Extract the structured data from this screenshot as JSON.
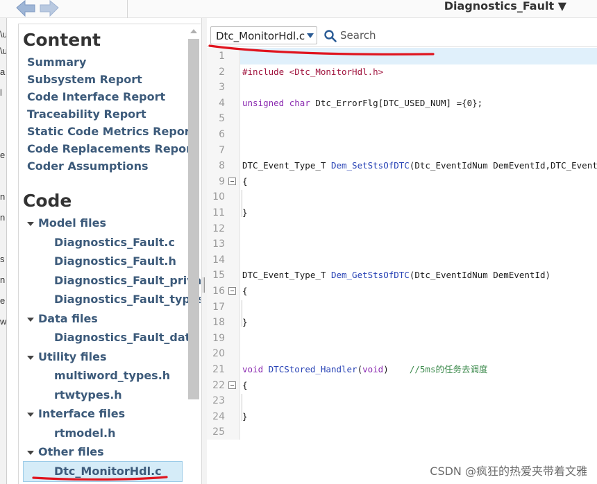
{
  "window": {
    "title": "Diagnostics_Fault ▼"
  },
  "content_panel": {
    "content_heading": "Content",
    "reports": [
      "Summary",
      "Subsystem Report",
      "Code Interface Report",
      "Traceability Report",
      "Static Code Metrics Report",
      "Code Replacements Report",
      "Coder Assumptions"
    ],
    "code_heading": "Code",
    "groups": [
      {
        "label": "Model files",
        "files": [
          "Diagnostics_Fault.c",
          "Diagnostics_Fault.h",
          "Diagnostics_Fault_priva",
          "Diagnostics_Fault_types"
        ]
      },
      {
        "label": "Data files",
        "files": [
          "Diagnostics_Fault_data"
        ]
      },
      {
        "label": "Utility files",
        "files": [
          "multiword_types.h",
          "rtwtypes.h"
        ]
      },
      {
        "label": "Interface files",
        "files": [
          "rtmodel.h"
        ]
      },
      {
        "label": "Other files",
        "files": [
          "Dtc_MonitorHdl.c"
        ]
      }
    ],
    "selected_file": "Dtc_MonitorHdl.c"
  },
  "code_view": {
    "file_selector_value": "Dtc_MonitorHdl.c",
    "search_placeholder": "Search",
    "lines": [
      {
        "num": "1",
        "text": ""
      },
      {
        "num": "2",
        "text": "#include <Dtc_MonitorHdl.h>"
      },
      {
        "num": "3",
        "text": ""
      },
      {
        "num": "4",
        "text": "unsigned char Dtc_ErrorFlg[DTC_USED_NUM] ={0};"
      },
      {
        "num": "5",
        "text": ""
      },
      {
        "num": "6",
        "text": ""
      },
      {
        "num": "7",
        "text": ""
      },
      {
        "num": "8",
        "text": "DTC_Event_Type_T Dem_SetStsOfDTC(Dtc_EventIdNum DemEventId,DTC_Event"
      },
      {
        "num": "9",
        "text": "{"
      },
      {
        "num": "10",
        "text": ""
      },
      {
        "num": "11",
        "text": "}"
      },
      {
        "num": "12",
        "text": ""
      },
      {
        "num": "13",
        "text": ""
      },
      {
        "num": "14",
        "text": ""
      },
      {
        "num": "15",
        "text": "DTC_Event_Type_T Dem_GetStsOfDTC(Dtc_EventIdNum DemEventId)"
      },
      {
        "num": "16",
        "text": "{"
      },
      {
        "num": "17",
        "text": ""
      },
      {
        "num": "18",
        "text": "}"
      },
      {
        "num": "19",
        "text": ""
      },
      {
        "num": "20",
        "text": ""
      },
      {
        "num": "21",
        "text": "void DTCStored_Handler(void)    //5ms的任务去调度"
      },
      {
        "num": "22",
        "text": "{"
      },
      {
        "num": "23",
        "text": ""
      },
      {
        "num": "24",
        "text": "}"
      },
      {
        "num": "25",
        "text": ""
      }
    ]
  },
  "watermark": "CSDN @疯狂的热爱夹带着文雅",
  "colors": {
    "link": "#3c5a7a",
    "selected_bg": "#d5ecf8",
    "annotation": "#e0141e",
    "current_line": "#e0f0fb"
  }
}
